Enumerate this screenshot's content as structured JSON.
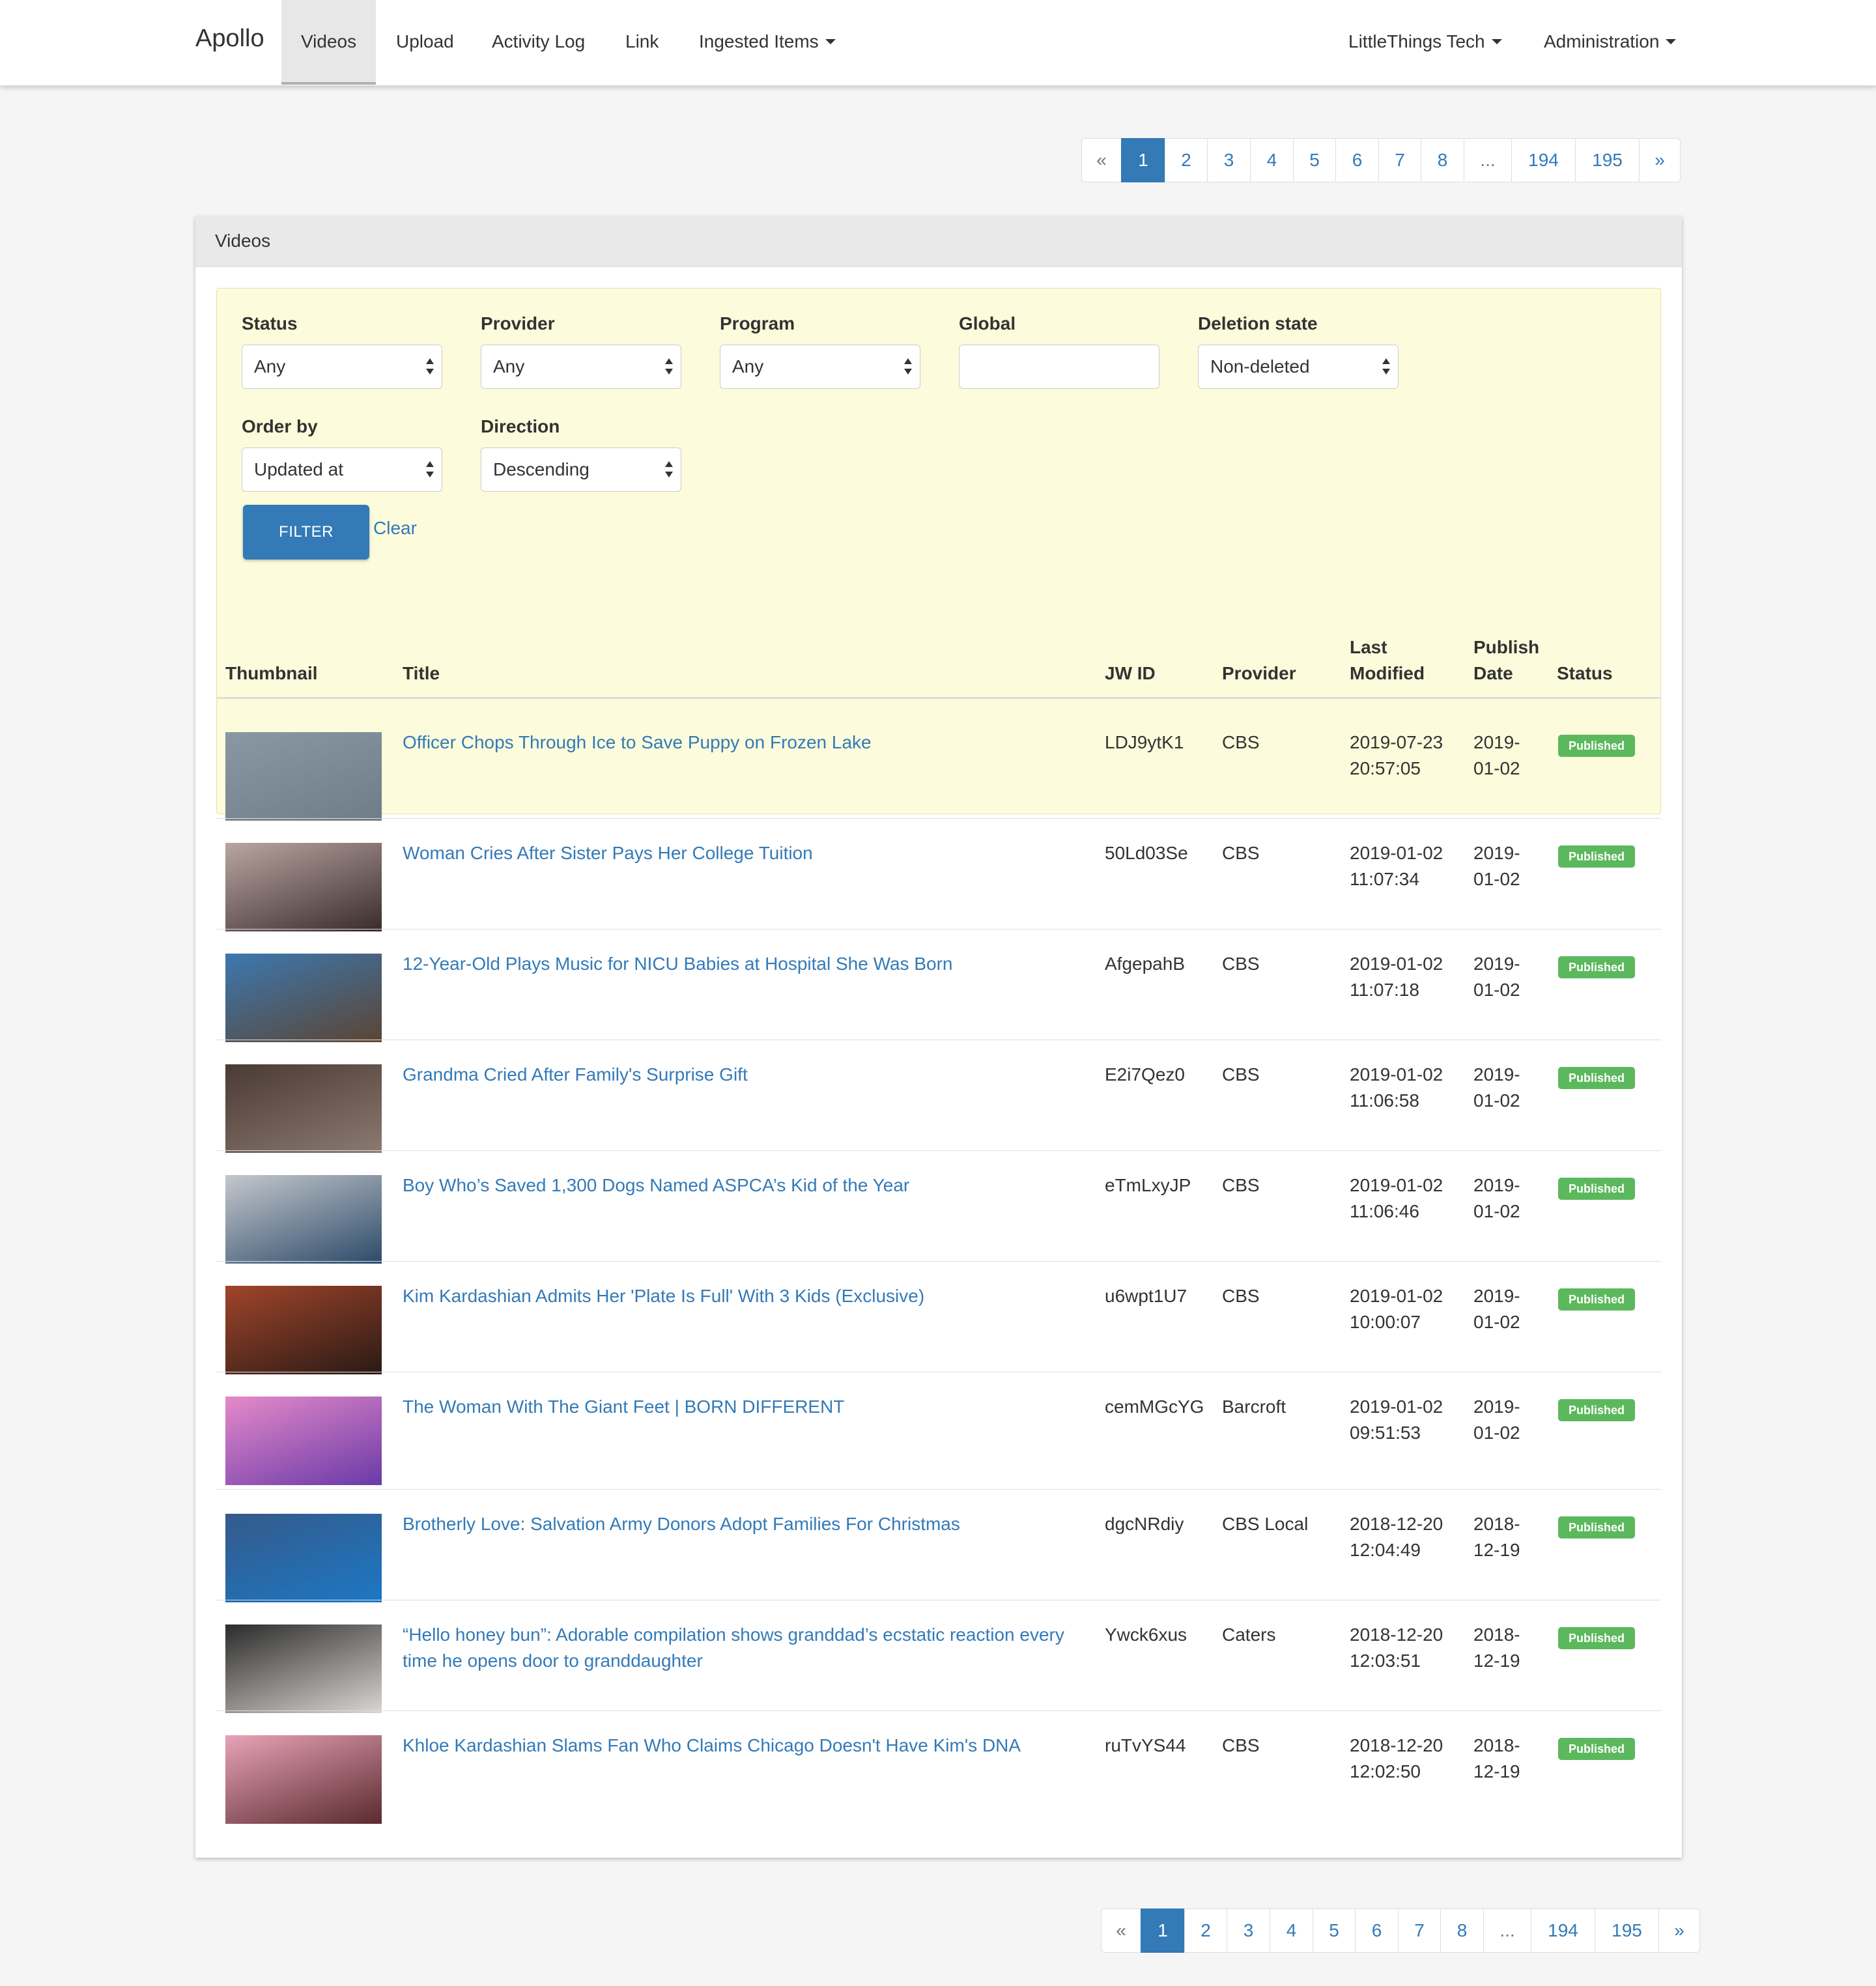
{
  "nav": {
    "brand": "Apollo",
    "items": [
      "Videos",
      "Upload",
      "Activity Log",
      "Link",
      "Ingested Items"
    ],
    "right": [
      "LittleThings Tech",
      "Administration"
    ]
  },
  "pagination": {
    "prev": "«",
    "pages": [
      "1",
      "2",
      "3",
      "4",
      "5",
      "6",
      "7",
      "8"
    ],
    "ellipsis": "...",
    "last_pages": [
      "194",
      "195"
    ],
    "next": "»",
    "current": "1"
  },
  "panel": {
    "title": "Videos"
  },
  "filters": {
    "status": {
      "label": "Status",
      "value": "Any"
    },
    "provider": {
      "label": "Provider",
      "value": "Any"
    },
    "program": {
      "label": "Program",
      "value": "Any"
    },
    "global": {
      "label": "Global",
      "value": ""
    },
    "deletion": {
      "label": "Deletion state",
      "value": "Non-deleted"
    },
    "order_by": {
      "label": "Order by",
      "value": "Updated at"
    },
    "direction": {
      "label": "Direction",
      "value": "Descending"
    },
    "filter_button": "FILTER",
    "clear_link": "Clear"
  },
  "table": {
    "headers": {
      "thumbnail": "Thumbnail",
      "title": "Title",
      "jwid": "JW ID",
      "provider": "Provider",
      "modified_1": "Last",
      "modified_2": "Modified",
      "publish_1": "Publish",
      "publish_2": "Date",
      "status": "Status"
    },
    "rows": [
      {
        "title_1": "Officer Chops Through Ice to Save Puppy on Frozen Lake",
        "title_2": "",
        "jwid": "LDJ9ytK1",
        "provider": "CBS",
        "mod_date": "2019-07-23",
        "mod_time": "20:57:05",
        "pub_1": "2019-",
        "pub_2": "01-02",
        "status": "Published",
        "thumb_colors": [
          "#8a98a3",
          "#6f7d88"
        ]
      },
      {
        "title_1": "Woman Cries After Sister Pays Her College Tuition",
        "title_2": "",
        "jwid": "50Ld03Se",
        "provider": "CBS",
        "mod_date": "2019-01-02",
        "mod_time": "11:07:34",
        "pub_1": "2019-",
        "pub_2": "01-02",
        "status": "Published",
        "thumb_colors": [
          "#b9a6a2",
          "#3a2c2c"
        ]
      },
      {
        "title_1": "12-Year-Old Plays Music for NICU Babies at Hospital She Was Born",
        "title_2": "",
        "jwid": "AfgepahB",
        "provider": "CBS",
        "mod_date": "2019-01-02",
        "mod_time": "11:07:18",
        "pub_1": "2019-",
        "pub_2": "01-02",
        "status": "Published",
        "thumb_colors": [
          "#3c78b0",
          "#5b4534"
        ]
      },
      {
        "title_1": "Grandma Cried After Family's Surprise Gift",
        "title_2": "",
        "jwid": "E2i7Qez0",
        "provider": "CBS",
        "mod_date": "2019-01-02",
        "mod_time": "11:06:58",
        "pub_1": "2019-",
        "pub_2": "01-02",
        "status": "Published",
        "thumb_colors": [
          "#4a3a34",
          "#8a7a70"
        ]
      },
      {
        "title_1": "Boy Who’s Saved 1,300 Dogs Named ASPCA’s Kid of the Year",
        "title_2": "",
        "jwid": "eTmLxyJP",
        "provider": "CBS",
        "mod_date": "2019-01-02",
        "mod_time": "11:06:46",
        "pub_1": "2019-",
        "pub_2": "01-02",
        "status": "Published",
        "thumb_colors": [
          "#c4c8cc",
          "#2d4a6a"
        ]
      },
      {
        "title_1": "Kim Kardashian Admits Her 'Plate Is Full' With 3 Kids (Exclusive)",
        "title_2": "",
        "jwid": "u6wpt1U7",
        "provider": "CBS",
        "mod_date": "2019-01-02",
        "mod_time": "10:00:07",
        "pub_1": "2019-",
        "pub_2": "01-02",
        "status": "Published",
        "thumb_colors": [
          "#a0452a",
          "#2a1a16"
        ]
      },
      {
        "title_1": "The Woman With The Giant Feet | BORN DIFFERENT",
        "title_2": "",
        "jwid": "cemMGcYG",
        "provider": "Barcroft",
        "mod_date": "2019-01-02",
        "mod_time": "09:51:53",
        "pub_1": "2019-",
        "pub_2": "01-02",
        "status": "Published",
        "thumb_colors": [
          "#e58ac9",
          "#6a3aa8"
        ]
      },
      {
        "title_1": "Brotherly Love: Salvation Army Donors Adopt Families For Christmas",
        "title_2": "",
        "jwid": "dgcNRdiy",
        "provider": "CBS Local",
        "mod_date": "2018-12-20",
        "mod_time": "12:04:49",
        "pub_1": "2018-",
        "pub_2": "12-19",
        "status": "Published",
        "thumb_colors": [
          "#355a8a",
          "#1c77c4"
        ]
      },
      {
        "title_1": "“Hello honey bun”: Adorable compilation shows granddad’s ecstatic reaction every",
        "title_2": "time he opens door to granddaughter",
        "jwid": "Ywck6xus",
        "provider": "Caters",
        "mod_date": "2018-12-20",
        "mod_time": "12:03:51",
        "pub_1": "2018-",
        "pub_2": "12-19",
        "status": "Published",
        "thumb_colors": [
          "#2b2b2b",
          "#d9d6d2"
        ]
      },
      {
        "title_1": "Khloe Kardashian Slams Fan Who Claims Chicago Doesn't Have Kim's DNA",
        "title_2": "",
        "jwid": "ruTvYS44",
        "provider": "CBS",
        "mod_date": "2018-12-20",
        "mod_time": "12:02:50",
        "pub_1": "2018-",
        "pub_2": "12-19",
        "status": "Published",
        "thumb_colors": [
          "#e8a3b8",
          "#5a2a2e"
        ]
      }
    ]
  },
  "colors": {
    "link": "#337ab7",
    "published": "#5cb85c",
    "filter_bg": "#fcfcdc"
  }
}
